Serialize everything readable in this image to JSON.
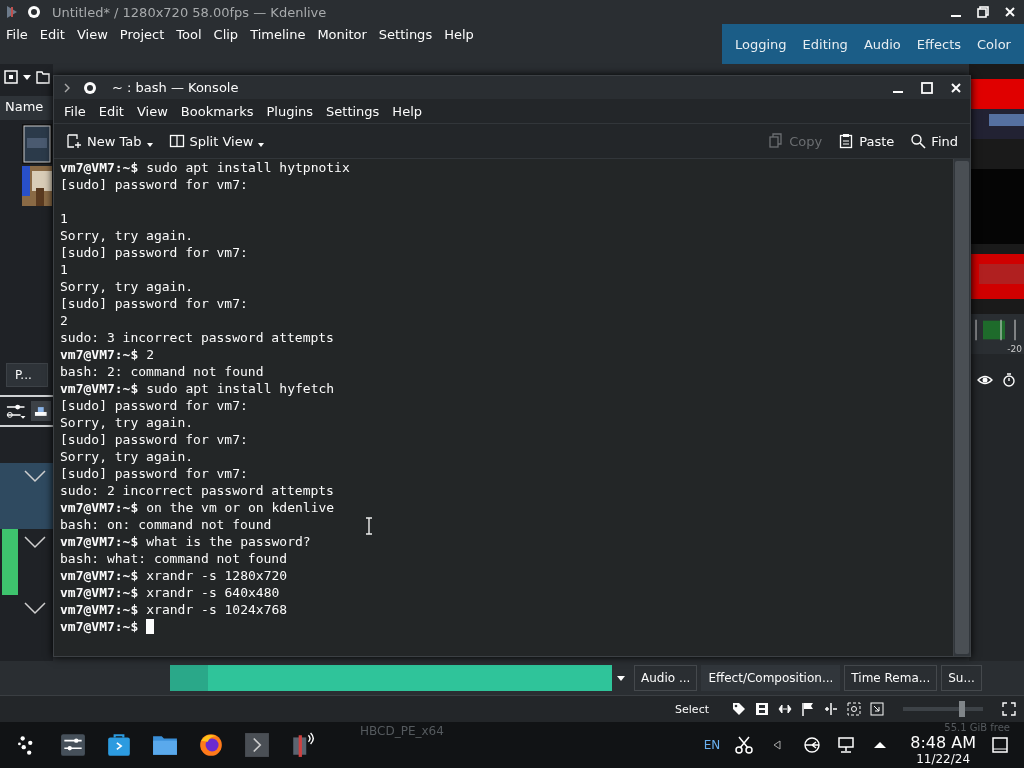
{
  "app": {
    "title": "Untitled* / 1280x720 58.00fps — Kdenlive",
    "menu": [
      "File",
      "Edit",
      "View",
      "Project",
      "Tool",
      "Clip",
      "Timeline",
      "Monitor",
      "Settings",
      "Help"
    ],
    "workspaces": [
      "Logging",
      "Editing",
      "Audio",
      "Effects",
      "Color"
    ],
    "bin_header": "Name",
    "bin_tab": "P...",
    "meter_label": "-20",
    "bottom_tabs": [
      {
        "label": "Audio ...",
        "selected": false
      },
      {
        "label": "Effect/Composition...",
        "selected": true
      },
      {
        "label": "Time Rema...",
        "selected": false
      },
      {
        "label": "Su...",
        "selected": false
      }
    ],
    "status_tool": "Select",
    "zoom_slider": {
      "level": 0.75
    },
    "behind_taskbar": "HBCD_PE_x64",
    "free_space": "55.1 GiB free"
  },
  "konsole": {
    "title": "~ : bash — Konsole",
    "menu": [
      "File",
      "Edit",
      "View",
      "Bookmarks",
      "Plugins",
      "Settings",
      "Help"
    ],
    "toolbar": [
      {
        "label": "New Tab",
        "kind": "newtab",
        "disabled": false
      },
      {
        "label": "Split View",
        "kind": "split",
        "disabled": false
      },
      {
        "label": "Copy",
        "kind": "copy",
        "disabled": true
      },
      {
        "label": "Paste",
        "kind": "paste",
        "disabled": false
      },
      {
        "label": "Find",
        "kind": "find",
        "disabled": false
      }
    ],
    "lines": [
      {
        "kind": "prompt",
        "prompt": "vm7@VM7:~$",
        "text": "sudo apt install hytpnotix"
      },
      {
        "kind": "output",
        "text": "[sudo] password for vm7:"
      },
      {
        "kind": "blank"
      },
      {
        "kind": "output",
        "text": "1"
      },
      {
        "kind": "output",
        "text": "Sorry, try again."
      },
      {
        "kind": "output",
        "text": "[sudo] password for vm7:"
      },
      {
        "kind": "output",
        "text": "1"
      },
      {
        "kind": "output",
        "text": "Sorry, try again."
      },
      {
        "kind": "output",
        "text": "[sudo] password for vm7:"
      },
      {
        "kind": "output",
        "text": "2"
      },
      {
        "kind": "output",
        "text": "sudo: 3 incorrect password attempts"
      },
      {
        "kind": "prompt",
        "prompt": "vm7@VM7:~$",
        "text": "2"
      },
      {
        "kind": "output",
        "text": "bash: 2: command not found"
      },
      {
        "kind": "prompt",
        "prompt": "vm7@VM7:~$",
        "text": "sudo apt install hyfetch"
      },
      {
        "kind": "output",
        "text": "[sudo] password for vm7:"
      },
      {
        "kind": "output",
        "text": "Sorry, try again."
      },
      {
        "kind": "output",
        "text": "[sudo] password for vm7:"
      },
      {
        "kind": "output",
        "text": "Sorry, try again."
      },
      {
        "kind": "output",
        "text": "[sudo] password for vm7:"
      },
      {
        "kind": "output",
        "text": "sudo: 2 incorrect password attempts"
      },
      {
        "kind": "prompt",
        "prompt": "vm7@VM7:~$",
        "text": "on the vm or on kdenlive"
      },
      {
        "kind": "output",
        "text": "bash: on: command not found"
      },
      {
        "kind": "prompt",
        "prompt": "vm7@VM7:~$",
        "text": "what is the password?"
      },
      {
        "kind": "output",
        "text": "bash: what: command not found"
      },
      {
        "kind": "prompt",
        "prompt": "vm7@VM7:~$",
        "text": "xrandr -s 1280x720"
      },
      {
        "kind": "prompt",
        "prompt": "vm7@VM7:~$",
        "text": "xrandr -s 640x480"
      },
      {
        "kind": "prompt",
        "prompt": "vm7@VM7:~$",
        "text": "xrandr -s 1024x768"
      },
      {
        "kind": "prompt",
        "prompt": "vm7@VM7:~$"
      }
    ],
    "cursor": true
  },
  "taskbar": {
    "language": "EN",
    "time": "8:48 AM",
    "date": "11/22/24"
  }
}
